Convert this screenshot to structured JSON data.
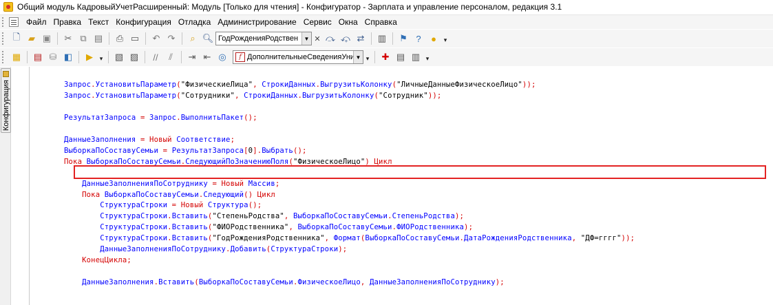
{
  "window": {
    "title": "Общий модуль КадровыйУчетРасширенный: Модуль [Только для чтения] - Конфигуратор - Зарплата и управление персоналом, редакция 3.1"
  },
  "menu": {
    "items": [
      "Файл",
      "Правка",
      "Текст",
      "Конфигурация",
      "Отладка",
      "Администрирование",
      "Сервис",
      "Окна",
      "Справка"
    ]
  },
  "toolbar": {
    "search_value": "ГодРожденияРодствен",
    "procedure_value": "ДополнительныеСведенияУни"
  },
  "side_panel": {
    "label": "Конфигурация"
  },
  "code": {
    "lines": [
      [
        [
          "Запрос",
          "i"
        ],
        [
          ".",
          "p"
        ],
        [
          "УстановитьПараметр",
          "i"
        ],
        [
          "(",
          "p"
        ],
        [
          "\"ФизическиеЛица\"",
          "s"
        ],
        [
          ", ",
          "p"
        ],
        [
          "СтрокиДанных",
          "i"
        ],
        [
          ".",
          "p"
        ],
        [
          "ВыгрузитьКолонку",
          "i"
        ],
        [
          "(",
          "p"
        ],
        [
          "\"ЛичныеДанныеФизическоеЛицо\"",
          "s"
        ],
        [
          ")",
          "p"
        ],
        [
          ");",
          "p"
        ]
      ],
      [
        [
          "Запрос",
          "i"
        ],
        [
          ".",
          "p"
        ],
        [
          "УстановитьПараметр",
          "i"
        ],
        [
          "(",
          "p"
        ],
        [
          "\"Сотрудники\"",
          "s"
        ],
        [
          ", ",
          "p"
        ],
        [
          "СтрокиДанных",
          "i"
        ],
        [
          ".",
          "p"
        ],
        [
          "ВыгрузитьКолонку",
          "i"
        ],
        [
          "(",
          "p"
        ],
        [
          "\"Сотрудник\"",
          "s"
        ],
        [
          ")",
          "p"
        ],
        [
          ");",
          "p"
        ]
      ],
      [],
      [
        [
          "РезультатЗапроса",
          "i"
        ],
        [
          " = ",
          "p"
        ],
        [
          "Запрос",
          "i"
        ],
        [
          ".",
          "p"
        ],
        [
          "ВыполнитьПакет",
          "i"
        ],
        [
          "();",
          "p"
        ]
      ],
      [],
      [
        [
          "ДанныеЗаполнения",
          "i"
        ],
        [
          " = ",
          "p"
        ],
        [
          "Новый",
          "k"
        ],
        [
          " ",
          "p"
        ],
        [
          "Соответствие",
          "i"
        ],
        [
          ";",
          "p"
        ]
      ],
      [
        [
          "ВыборкаПоСоставуСемьи",
          "i"
        ],
        [
          " = ",
          "p"
        ],
        [
          "РезультатЗапроса",
          "i"
        ],
        [
          "[",
          "p"
        ],
        [
          "0",
          "s"
        ],
        [
          "].",
          "p"
        ],
        [
          "Выбрать",
          "i"
        ],
        [
          "();",
          "p"
        ]
      ],
      [
        [
          "Пока",
          "k"
        ],
        [
          " ",
          "p"
        ],
        [
          "ВыборкаПоСоставуСемьи",
          "i"
        ],
        [
          ".",
          "p"
        ],
        [
          "СледующийПоЗначениюПоля",
          "i"
        ],
        [
          "(",
          "p"
        ],
        [
          "\"ФизическоеЛицо\"",
          "s"
        ],
        [
          ") ",
          "p"
        ],
        [
          "Цикл",
          "k"
        ]
      ],
      [],
      [
        [
          "    ",
          "p"
        ],
        [
          "ДанныеЗаполненияПоСотруднику",
          "i"
        ],
        [
          " = ",
          "p"
        ],
        [
          "Новый",
          "k"
        ],
        [
          " ",
          "p"
        ],
        [
          "Массив",
          "i"
        ],
        [
          ";",
          "p"
        ]
      ],
      [
        [
          "    ",
          "p"
        ],
        [
          "Пока",
          "k"
        ],
        [
          " ",
          "p"
        ],
        [
          "ВыборкаПоСоставуСемьи",
          "i"
        ],
        [
          ".",
          "p"
        ],
        [
          "Следующий",
          "i"
        ],
        [
          "() ",
          "p"
        ],
        [
          "Цикл",
          "k"
        ]
      ],
      [
        [
          "        ",
          "p"
        ],
        [
          "СтруктураСтроки",
          "i"
        ],
        [
          " = ",
          "p"
        ],
        [
          "Новый",
          "k"
        ],
        [
          " ",
          "p"
        ],
        [
          "Структура",
          "i"
        ],
        [
          "();",
          "p"
        ]
      ],
      [
        [
          "        ",
          "p"
        ],
        [
          "СтруктураСтроки",
          "i"
        ],
        [
          ".",
          "p"
        ],
        [
          "Вставить",
          "i"
        ],
        [
          "(",
          "p"
        ],
        [
          "\"СтепеньРодства\"",
          "s"
        ],
        [
          ", ",
          "p"
        ],
        [
          "ВыборкаПоСоставуСемьи",
          "i"
        ],
        [
          ".",
          "p"
        ],
        [
          "СтепеньРодства",
          "i"
        ],
        [
          ");",
          "p"
        ]
      ],
      [
        [
          "        ",
          "p"
        ],
        [
          "СтруктураСтроки",
          "i"
        ],
        [
          ".",
          "p"
        ],
        [
          "Вставить",
          "i"
        ],
        [
          "(",
          "p"
        ],
        [
          "\"ФИОРодственника\"",
          "s"
        ],
        [
          ", ",
          "p"
        ],
        [
          "ВыборкаПоСоставуСемьи",
          "i"
        ],
        [
          ".",
          "p"
        ],
        [
          "ФИОРодственника",
          "i"
        ],
        [
          ");",
          "p"
        ]
      ],
      [
        [
          "        ",
          "p"
        ],
        [
          "СтруктураСтроки",
          "i"
        ],
        [
          ".",
          "p"
        ],
        [
          "Вставить",
          "i"
        ],
        [
          "(",
          "p"
        ],
        [
          "\"ГодРожденияРодственника\"",
          "s"
        ],
        [
          ", ",
          "p"
        ],
        [
          "Формат",
          "i"
        ],
        [
          "(",
          "p"
        ],
        [
          "ВыборкаПоСоставуСемьи",
          "i"
        ],
        [
          ".",
          "p"
        ],
        [
          "ДатаРожденияРодственника",
          "i"
        ],
        [
          ", ",
          "p"
        ],
        [
          "\"ДФ=гггг\"",
          "s"
        ],
        [
          "));",
          "p"
        ]
      ],
      [
        [
          "        ",
          "p"
        ],
        [
          "ДанныеЗаполненияПоСотруднику",
          "i"
        ],
        [
          ".",
          "p"
        ],
        [
          "Добавить",
          "i"
        ],
        [
          "(",
          "p"
        ],
        [
          "СтруктураСтроки",
          "i"
        ],
        [
          ");",
          "p"
        ]
      ],
      [
        [
          "    ",
          "p"
        ],
        [
          "КонецЦикла",
          "k"
        ],
        [
          ";",
          "p"
        ]
      ],
      [],
      [
        [
          "    ",
          "p"
        ],
        [
          "ДанныеЗаполнения",
          "i"
        ],
        [
          ".",
          "p"
        ],
        [
          "Вставить",
          "i"
        ],
        [
          "(",
          "p"
        ],
        [
          "ВыборкаПоСоставуСемьи",
          "i"
        ],
        [
          ".",
          "p"
        ],
        [
          "ФизическоеЛицо",
          "i"
        ],
        [
          ", ",
          "p"
        ],
        [
          "ДанныеЗаполненияПоСотруднику",
          "i"
        ],
        [
          ");",
          "p"
        ]
      ]
    ]
  },
  "colors": {
    "identifier": "#0000ff",
    "keyword": "#d40000",
    "string": "#000000",
    "highlight_border": "#e32222"
  },
  "icons": {
    "toolbar1": [
      "new-document-icon",
      "open-folder-icon",
      "save-icon",
      "cut-icon",
      "copy-icon",
      "paste-icon",
      "print-icon",
      "print-preview-icon",
      "undo-icon",
      "redo-icon",
      "find-in-text-icon",
      "find-icon",
      "find-next-icon",
      "find-prev-icon",
      "replace-icon",
      "bookmark-icon",
      "syntax-assistant-icon",
      "help-icon",
      "info-icon"
    ],
    "toolbar2": [
      "config-tree-icon",
      "module-structure-icon",
      "database-icon",
      "update-config-icon",
      "start-debug-icon",
      "module-icon",
      "form-icon",
      "comment-icon",
      "uncomment-icon",
      "indent-icon",
      "outdent-icon",
      "procedure-list-icon",
      "add-bookmark-icon",
      "remove-bookmark-icon",
      "block-icon"
    ]
  }
}
